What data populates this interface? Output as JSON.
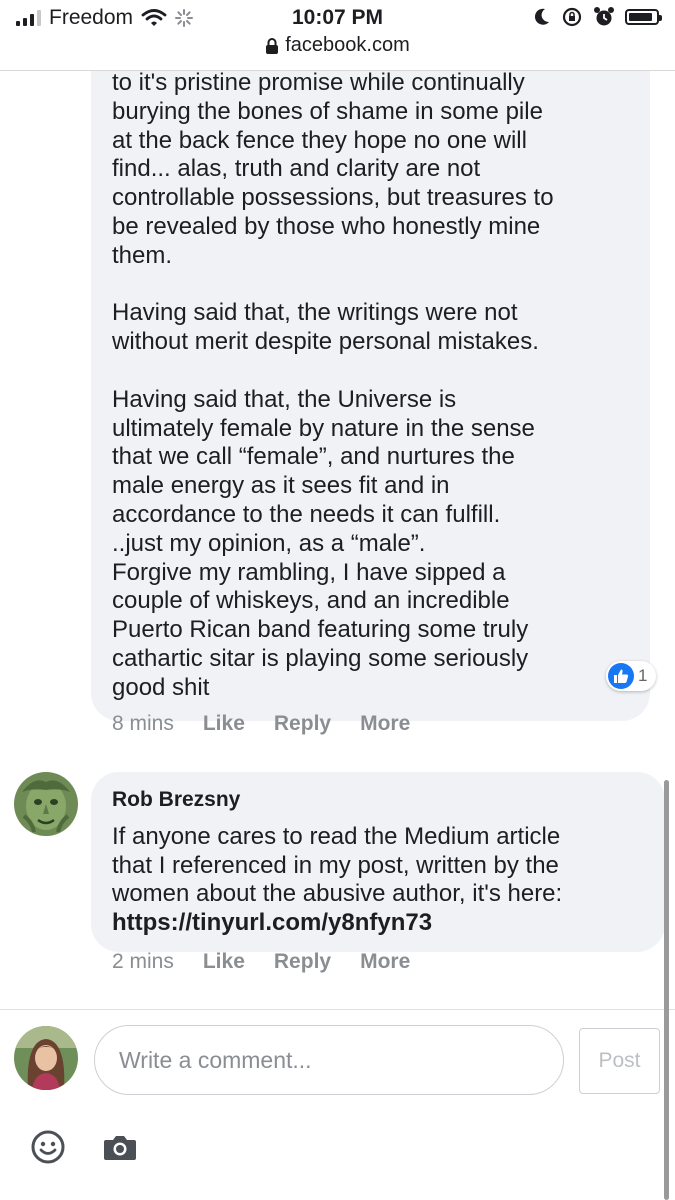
{
  "status_bar": {
    "carrier": "Freedom",
    "time": "10:07 PM"
  },
  "browser": {
    "url": "facebook.com"
  },
  "comment_1": {
    "paragraphs": [
      "to it's pristine promise while continually\nburying the bones of shame in some pile\nat the back fence they hope no one will\nfind... alas, truth and clarity are not\ncontrollable possessions, but treasures to\nbe revealed by those who honestly mine\nthem.",
      "Having said that, the writings were not\nwithout merit despite personal mistakes.",
      "Having said that, the Universe is\nultimately female by nature in the sense\nthat we call “female”, and nurtures the\nmale energy as it sees fit and in\naccordance to the needs it can fulfill.\n..just my opinion, as a “male”.\nForgive my rambling, I have sipped a\ncouple of whiskeys, and an incredible\nPuerto Rican band featuring some truly\ncathartic sitar is playing some seriously\ngood shit"
    ],
    "like_count": "1",
    "time": "8 mins",
    "like_label": "Like",
    "reply_label": "Reply",
    "more_label": "More"
  },
  "comment_2": {
    "author": "Rob Brezsny",
    "text": "If anyone cares to read the Medium article\nthat I referenced in my post, written by the\nwomen about the abusive author, it's here:",
    "link": "https://tinyurl.com/y8nfyn73",
    "time": "2 mins",
    "like_label": "Like",
    "reply_label": "Reply",
    "more_label": "More"
  },
  "composer": {
    "placeholder": "Write a comment...",
    "post_label": "Post",
    "icons": [
      "emoji-icon",
      "camera-icon"
    ]
  },
  "colors": {
    "bubble": "#f0f2f5",
    "like_blue": "#1877f2",
    "meta_text": "#8a8d91"
  }
}
